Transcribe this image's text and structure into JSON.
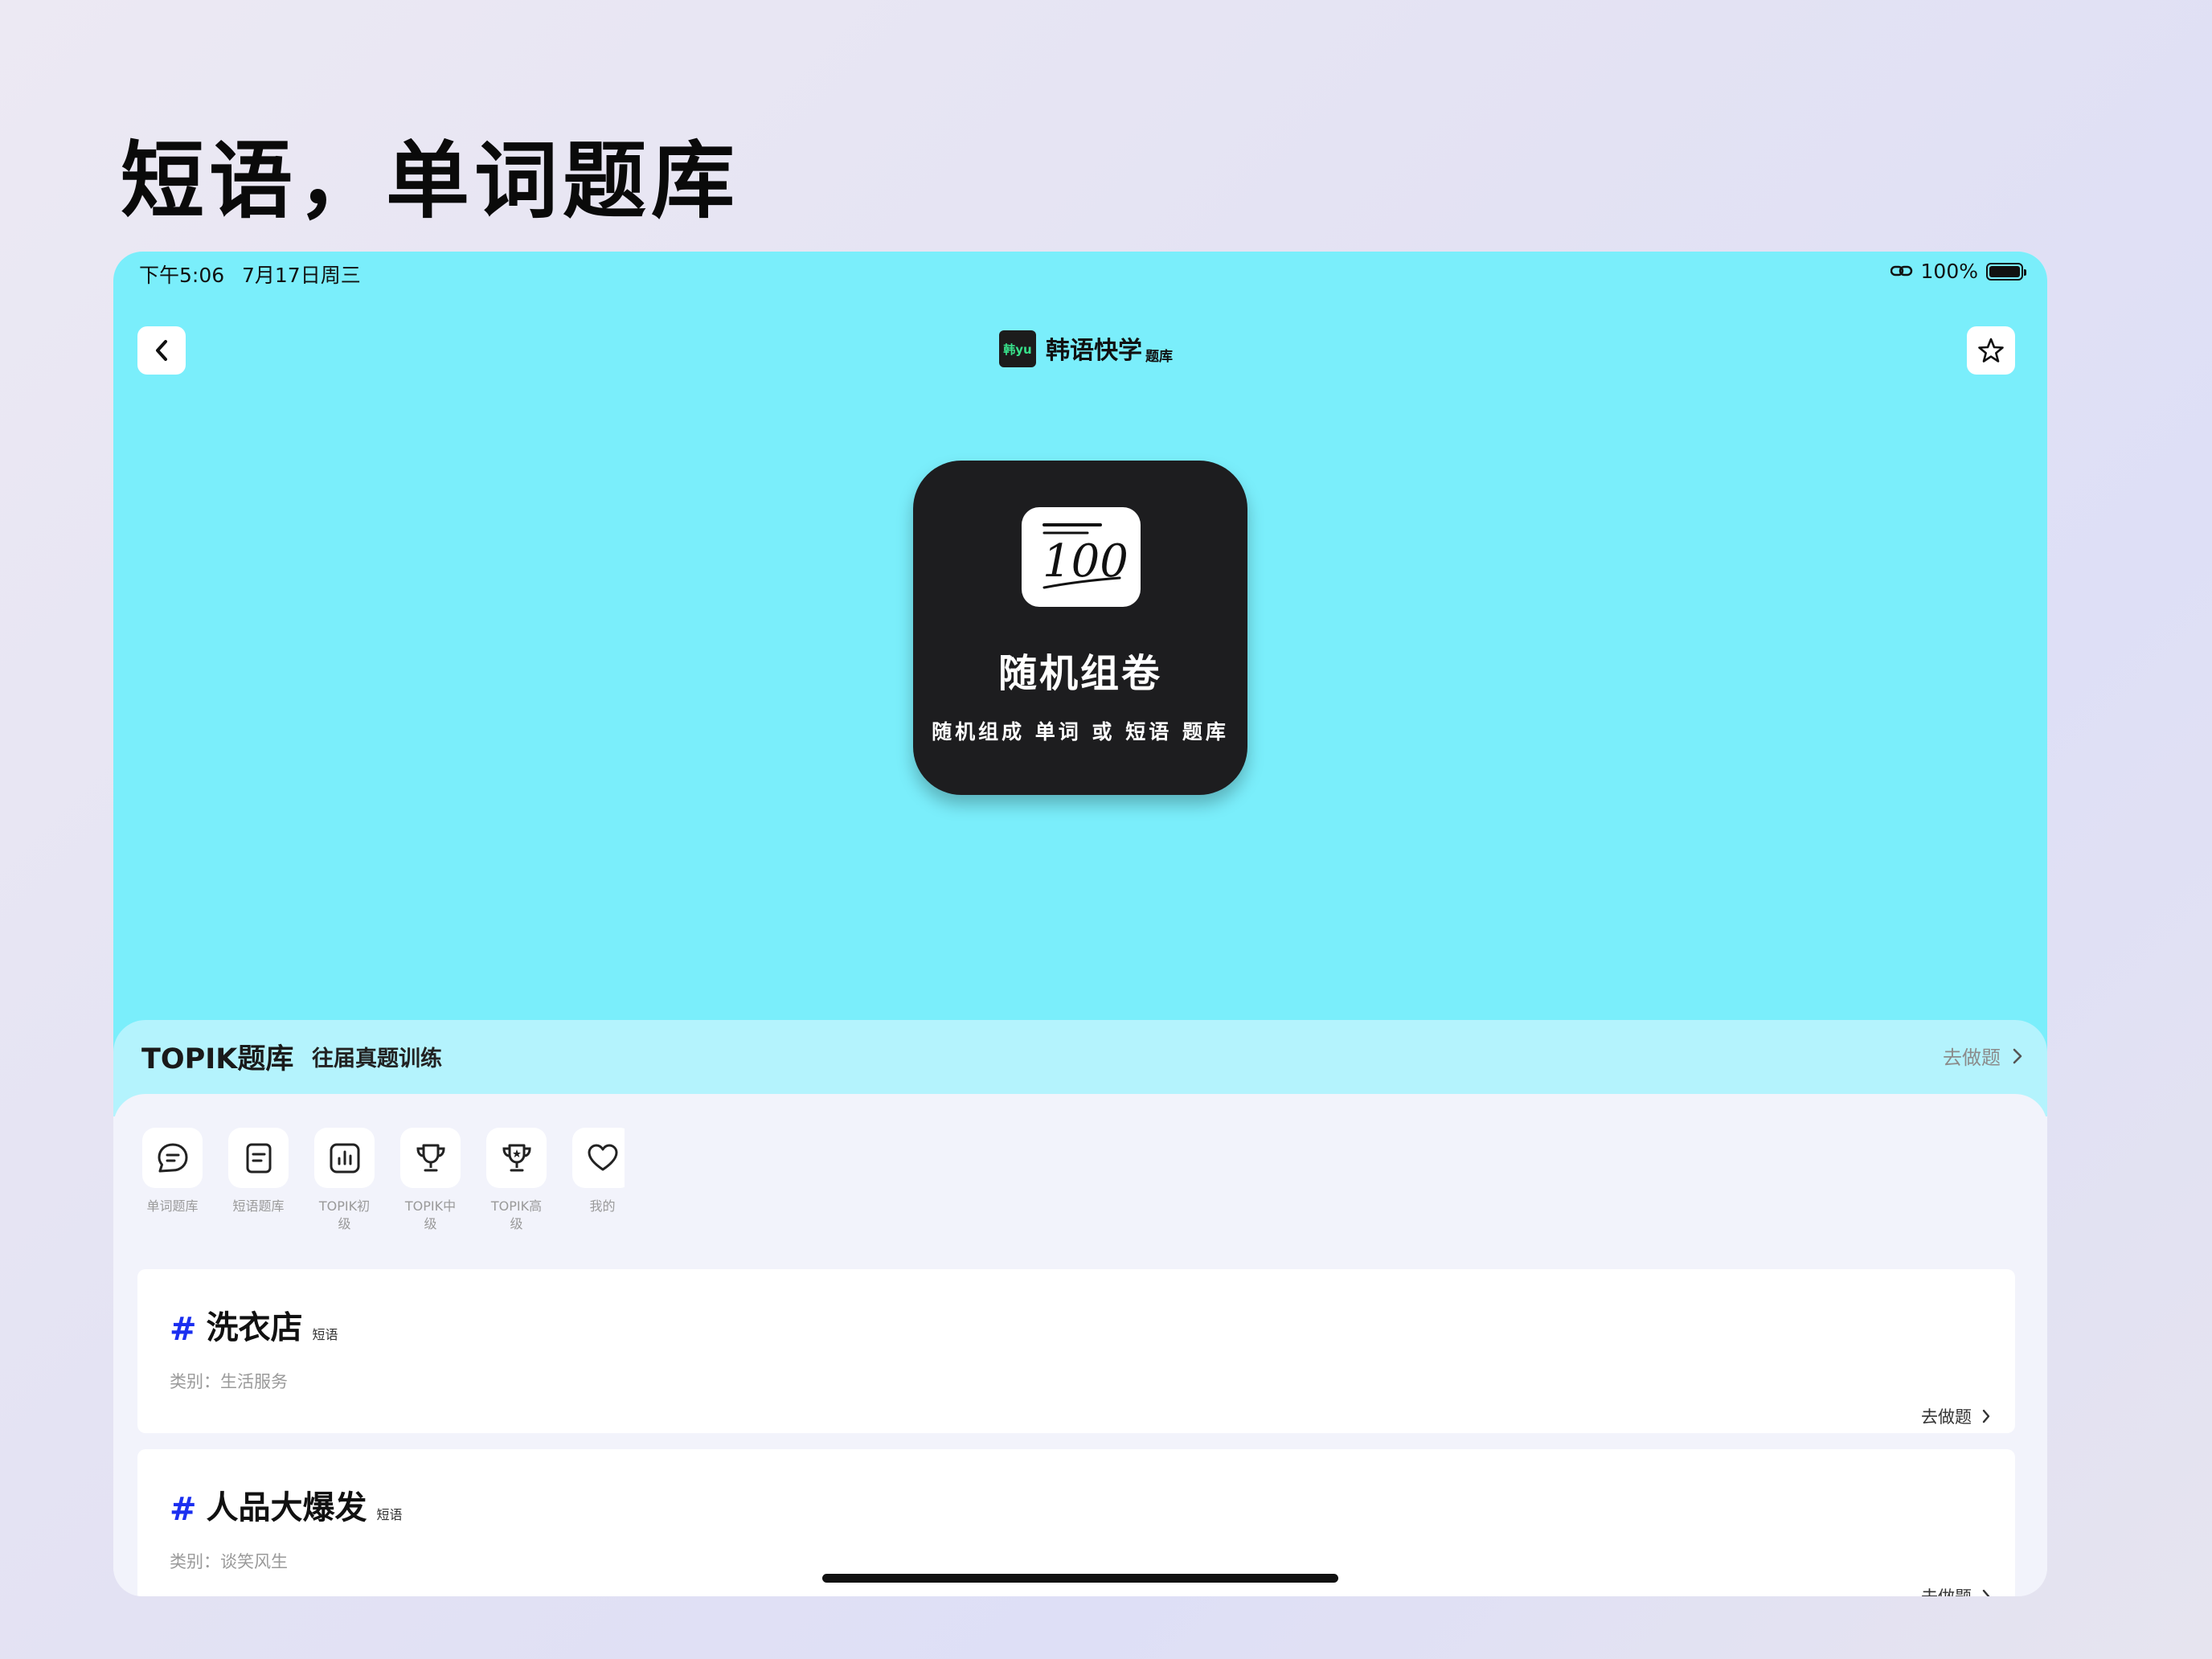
{
  "headline": "短语，单词题库",
  "status": {
    "time": "下午5:06",
    "date": "7月17日周三",
    "battery": "100%"
  },
  "brand": {
    "logo_text": "韩yu",
    "name": "韩语快学",
    "sub": "题库"
  },
  "random_card": {
    "title": "随机组卷",
    "subtitle": "随机组成 单词 或 短语 题库",
    "icon_text": "100"
  },
  "topik": {
    "title": "TOPIK题库",
    "subtitle": "往届真题训练",
    "go_label": "去做题"
  },
  "categories": [
    {
      "label": "单词题库"
    },
    {
      "label": "短语题库"
    },
    {
      "label": "TOPIK初级"
    },
    {
      "label": "TOPIK中级"
    },
    {
      "label": "TOPIK高级"
    },
    {
      "label": "我的"
    }
  ],
  "items": [
    {
      "hash": "#",
      "name": "洗衣店",
      "tag": "短语",
      "category_label": "类别：",
      "category": "生活服务",
      "go_label": "去做题"
    },
    {
      "hash": "#",
      "name": "人品大爆发",
      "tag": "短语",
      "category_label": "类别：",
      "category": "谈笑风生",
      "go_label": "去做题"
    }
  ]
}
